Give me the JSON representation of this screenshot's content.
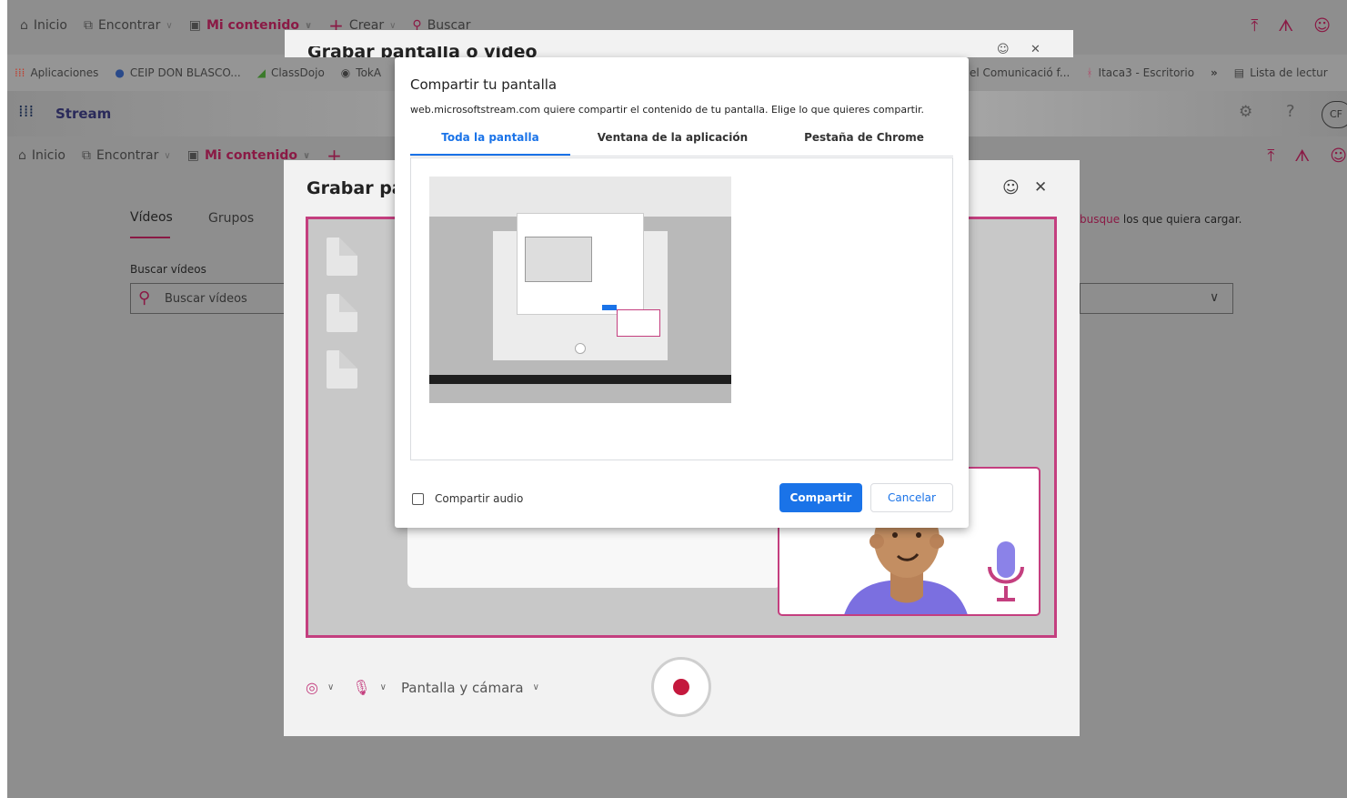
{
  "top_nav": {
    "inicio": "Inicio",
    "encontrar": "Encontrar",
    "mi_contenido": "Mi contenido",
    "crear": "Crear",
    "buscar": "Buscar"
  },
  "bookmarks": {
    "apps": "Aplicaciones",
    "ceip": "CEIP DON BLASCO...",
    "classdojo": "ClassDojo",
    "tok": "TokA",
    "comunicacio": "el Comunicació f...",
    "itaca": "Itaca3 - Escritorio",
    "more": "»",
    "lista": "Lista de lectur"
  },
  "stream": {
    "brand": "Stream",
    "avatar": "CF"
  },
  "second_nav": {
    "inicio": "Inicio",
    "encontrar": "Encontrar",
    "mi_contenido": "Mi contenido"
  },
  "page": {
    "tab_videos": "Vídeos",
    "tab_grupos": "Grupos",
    "search_label": "Buscar vídeos",
    "search_placeholder": "Buscar vídeos",
    "hint_link": "busque",
    "hint_rest": "los que quiera cargar."
  },
  "grabar_dialog_top": {
    "title": "Grabar pantalla o vídeo"
  },
  "grabar_dialog": {
    "title": "Grabar par",
    "mode": "Pantalla y cámara"
  },
  "share_dialog": {
    "title": "Compartir tu pantalla",
    "description": "web.microsoftstream.com quiere compartir el contenido de tu pantalla. Elige lo que quieres compartir.",
    "tabs": [
      "Toda la pantalla",
      "Ventana de la aplicación",
      "Pestaña de Chrome"
    ],
    "audio_label": "Compartir audio",
    "share_button": "Compartir",
    "cancel_button": "Cancelar"
  },
  "colors": {
    "accent": "#8a1a45",
    "frame": "#c43f7f",
    "chrome_blue": "#1a73e8",
    "record": "#c4183d"
  }
}
